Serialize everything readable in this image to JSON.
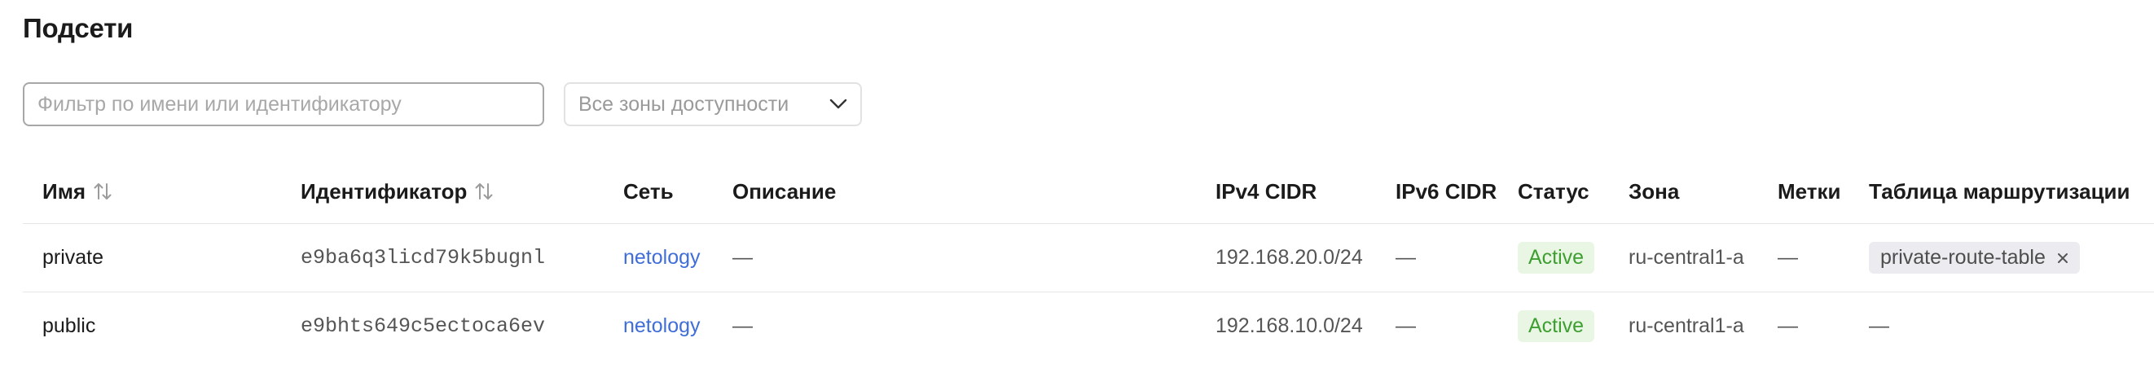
{
  "page": {
    "title": "Подсети"
  },
  "filter": {
    "placeholder": "Фильтр по имени или идентификатору",
    "zone_select_label": "Все зоны доступности"
  },
  "table": {
    "columns": {
      "name": "Имя",
      "id": "Идентификатор",
      "network": "Сеть",
      "description": "Описание",
      "ipv4": "IPv4 CIDR",
      "ipv6": "IPv6 CIDR",
      "status": "Статус",
      "zone": "Зона",
      "labels": "Метки",
      "route_table": "Таблица маршрутизации"
    },
    "rows": [
      {
        "name": "private",
        "id": "e9ba6q3licd79k5bugnl",
        "network": "netology",
        "description": "—",
        "ipv4": "192.168.20.0/24",
        "ipv6": "—",
        "status": "Active",
        "zone": "ru-central1-a",
        "labels": "—",
        "route_table": "private-route-table"
      },
      {
        "name": "public",
        "id": "e9bhts649c5ectoca6ev",
        "network": "netology",
        "description": "—",
        "ipv4": "192.168.10.0/24",
        "ipv6": "—",
        "status": "Active",
        "zone": "ru-central1-a",
        "labels": "—",
        "route_table": "—"
      }
    ]
  },
  "colors": {
    "link": "#3f6ed8",
    "status_active_text": "#3e9f31",
    "status_active_bg": "#e9f6e4",
    "chip_bg": "#ececf0"
  },
  "icons": {
    "sort": "sort-arrows-icon",
    "select": "chevron-down-icon",
    "chip_remove": "close-icon"
  }
}
